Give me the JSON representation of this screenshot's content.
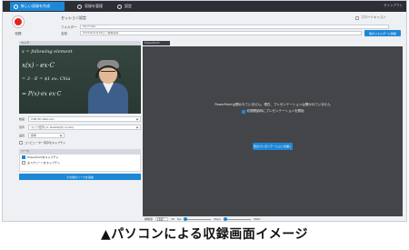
{
  "app": {
    "tabs": [
      {
        "label": "新しい収録を作成",
        "active": true
      },
      {
        "label": "収録を管理",
        "active": false
      },
      {
        "label": "設定",
        "active": false
      }
    ],
    "top_right": "サインアウト"
  },
  "record": {
    "label": "収録"
  },
  "session": {
    "title": "セッション設定",
    "folder_label": "フォルダー",
    "folder_value": "My Folder",
    "name_label": "名前",
    "name_value": "2021年12月16日 / 講義収録",
    "webcast_label": "ブロードキャスト",
    "folder_button": "他のフォルダーに移動"
  },
  "left": {
    "camera_header": "カメラ",
    "chalk_lines": [
      "x = following element",
      "x(x) - ex·C",
      "= 3 - E = $1  ex: Chia",
      "= P(x)·ex  ex·C"
    ],
    "video_label": "動画",
    "video_value": "USB HD Webcam",
    "audio_label": "音声",
    "audio_value": "マイク配列 (2- Realtek(R) Audio)",
    "quality_label": "品質",
    "quality_value": "標準",
    "capture_computer_audio": "コンピューター音声をキャプチャ",
    "sources_header": "ソース",
    "sources": [
      {
        "label": "PowerPointをキャプチャ",
        "checked": true
      },
      {
        "label": "主スクリーンをキャプチャ",
        "checked": false
      }
    ],
    "add_source_button": "その他のソースを追加"
  },
  "main": {
    "tab_label": "PowerPoint",
    "message": "PowerPointは開かれていません。現在、プレゼンテーションは開かれていません",
    "checkbox_label": "収録開始時にプレゼンテーションを開始",
    "open_button": "別のプレゼンテーションを開く"
  },
  "bottom": {
    "resolution_label": "解像度",
    "resolution_value": "1920 x 1080",
    "fps_label": "fps",
    "fps_value": "30",
    "kbps_label": "Kbps",
    "kbps_value": "3000"
  },
  "caption": "▲パソコンによる収録画面イメージ",
  "colors": {
    "accent": "#1e87d6",
    "record": "#e02424",
    "topbar": "#2c2f35"
  }
}
